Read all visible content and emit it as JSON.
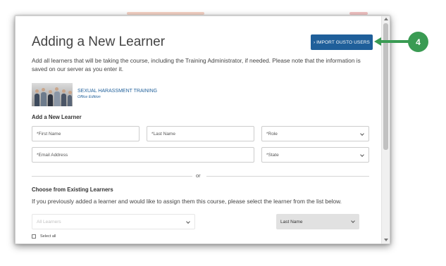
{
  "modal": {
    "title": "Adding a New Learner",
    "import_button_label": "› IMPORT GUSTO USERS",
    "intro_text": "Add all learners that will be taking the course, including the Training Administrator, if needed. Please note that the information is saved on our server as you enter it.",
    "course": {
      "name": "SEXUAL HARASSMENT TRAINING",
      "edition": "Office Edition"
    },
    "add_section": {
      "heading": "Add a New Learner",
      "first_name_placeholder": "*First Name",
      "last_name_placeholder": "*Last Name",
      "role_select_value": "*Role",
      "email_placeholder": "*Email Address",
      "state_select_value": "*State"
    },
    "divider_text": "or",
    "existing_section": {
      "heading": "Choose from Existing Learners",
      "description": "If you previously added a learner and would like to assign them this course, please select the learner from the list below.",
      "all_learners_value": "All Learners",
      "sort_value": "Last Name",
      "select_all_label": "Select all"
    }
  },
  "callout": {
    "number": "4",
    "color": "#3a9b53"
  },
  "colors": {
    "primary_button": "#1f5f9a",
    "link": "#1f5f9a"
  }
}
